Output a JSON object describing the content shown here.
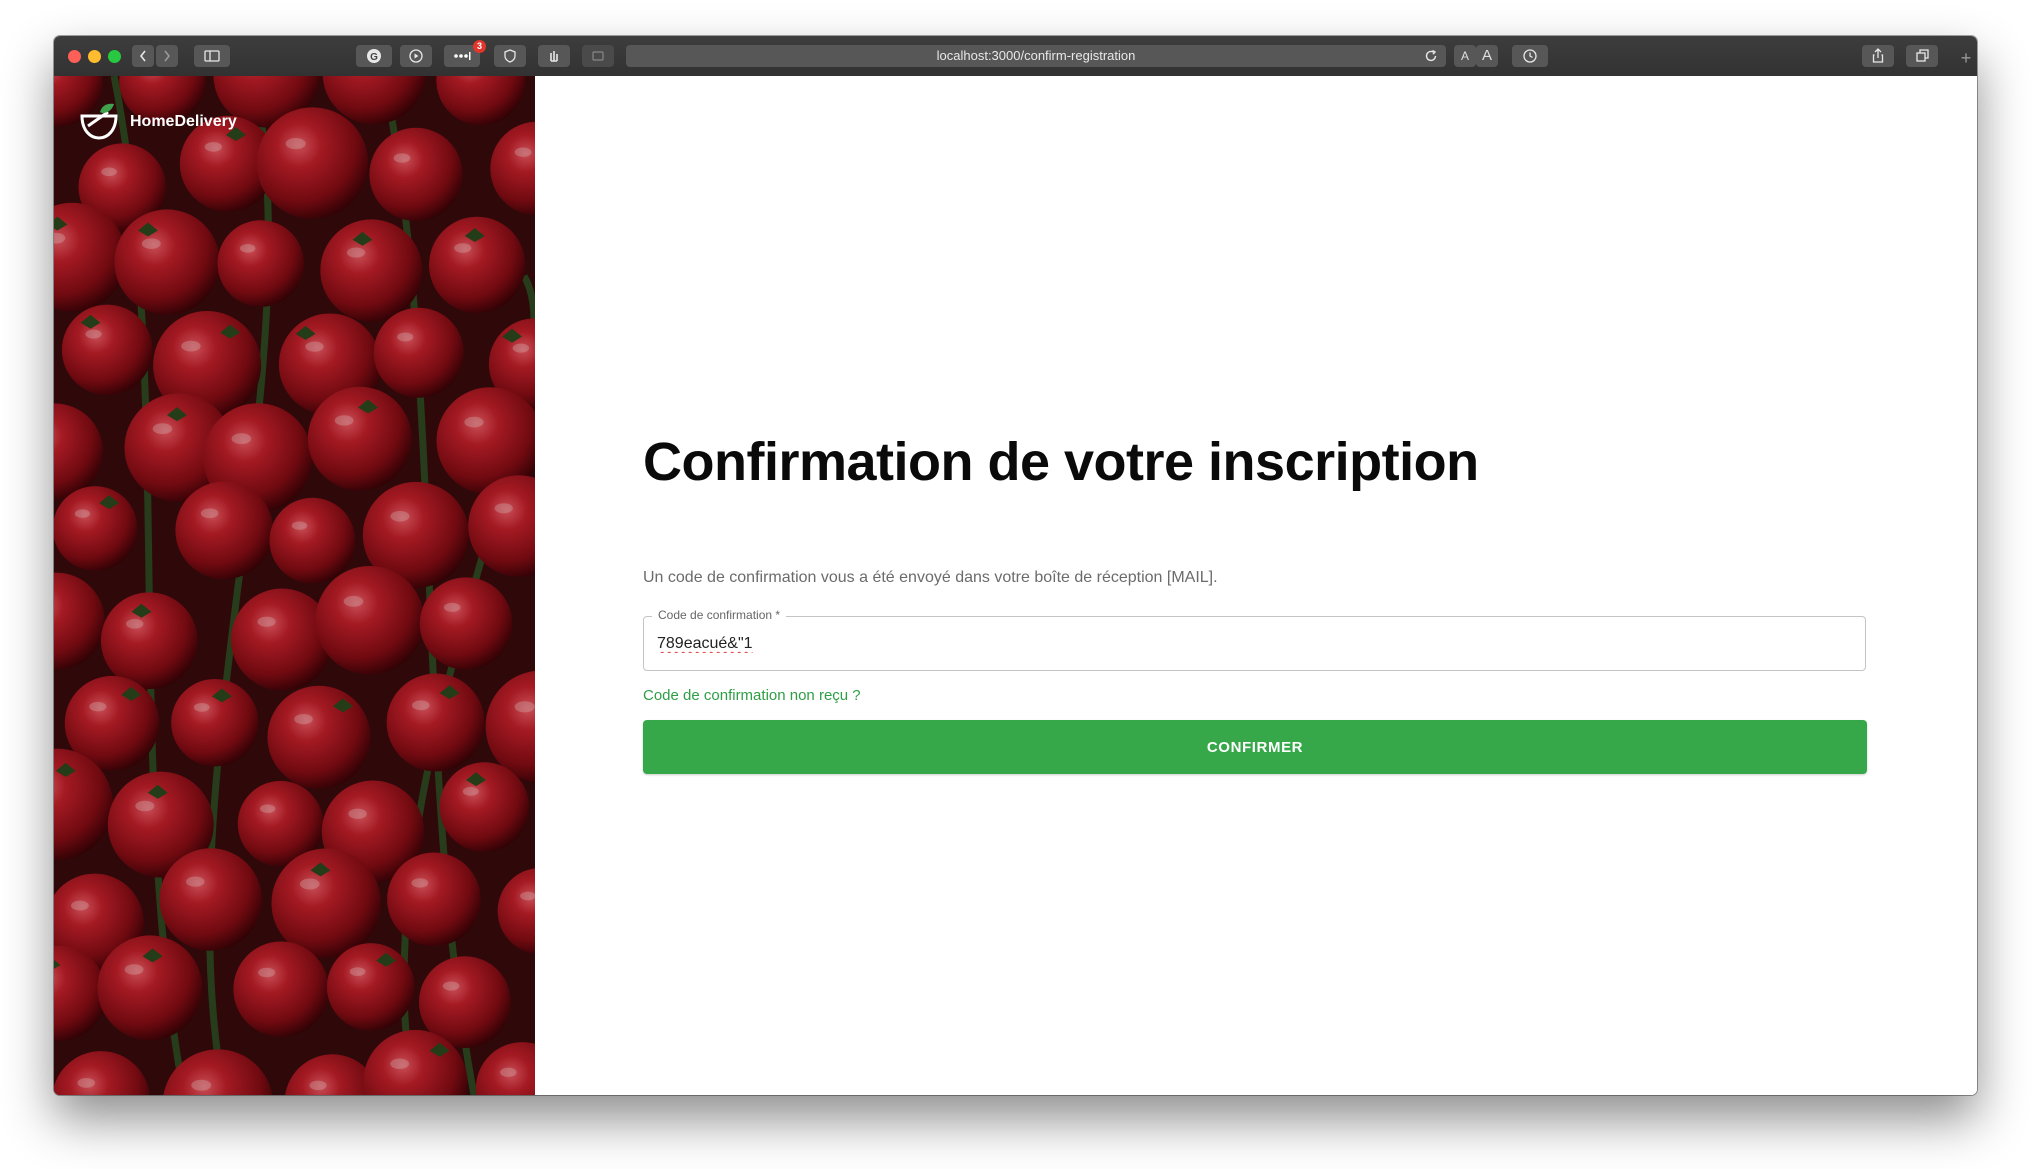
{
  "browser": {
    "url": "localhost:3000/confirm-registration",
    "extension_badge": "3",
    "text_size_small": "A",
    "text_size_large": "A"
  },
  "sidebar": {
    "brand_name": "HomeDelivery",
    "background": "tomatoes-photo"
  },
  "form": {
    "title": "Confirmation de votre inscription",
    "subtitle": "Un code de confirmation vous a été envoyé dans votre boîte de réception [MAIL].",
    "code_label": "Code de confirmation *",
    "code_value": "789eacué&\"1",
    "resend_link": "Code de confirmation non reçu ?",
    "confirm_button": "CONFIRMER"
  },
  "colors": {
    "accent": "#36a84a",
    "link": "#2e9e45",
    "title": "#0a0a0a"
  }
}
